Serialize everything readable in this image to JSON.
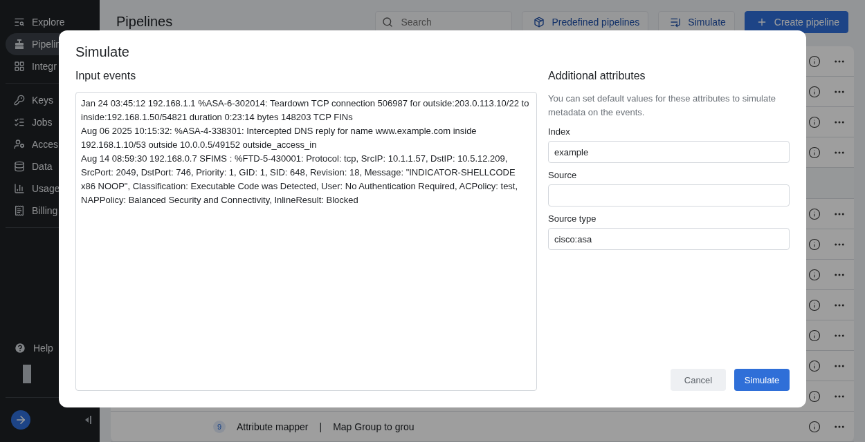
{
  "sidebar": {
    "groups": [
      [
        {
          "label": "Explore",
          "selected": false
        },
        {
          "label": "Pipelin",
          "selected": true
        },
        {
          "label": "Integr",
          "selected": false
        }
      ],
      [
        {
          "label": "Keys",
          "selected": false
        },
        {
          "label": "Jobs",
          "selected": false
        },
        {
          "label": "Acces",
          "selected": false
        },
        {
          "label": "Data",
          "selected": false
        },
        {
          "label": "Usage",
          "selected": false
        },
        {
          "label": "Billing",
          "selected": false
        }
      ]
    ],
    "help": "Help"
  },
  "header": {
    "title": "Pipelines",
    "search": {
      "placeholder": "Search"
    },
    "buttons": [
      {
        "label": "Predefined pipelines",
        "kind": "secondary"
      },
      {
        "label": "Simulate",
        "kind": "secondary"
      },
      {
        "label": "Create pipeline",
        "kind": "primary"
      }
    ]
  },
  "table": {
    "rows": [
      {
        "kind": "pipeline"
      },
      {
        "kind": "pipeline"
      },
      {
        "kind": "pipeline"
      },
      {
        "kind": "pipeline"
      },
      {
        "kind": "group"
      },
      {
        "kind": "pipeline"
      },
      {
        "kind": "pipeline"
      },
      {
        "kind": "pipeline"
      },
      {
        "kind": "pipeline"
      },
      {
        "kind": "pipeline"
      },
      {
        "kind": "pipeline"
      },
      {
        "kind": "pipeline"
      },
      {
        "kind": "pipeline",
        "number": "9",
        "name": "Attribute mapper",
        "separator": "|",
        "description": "Map Group to grou"
      }
    ]
  },
  "dialog": {
    "title": "Simulate",
    "input_label": "Input events",
    "events": [
      "Jan 24 03:45:12 192.168.1.1 %ASA-6-302014: Teardown TCP connection 506987 for outside:203.0.113.10/22 to inside:192.168.1.50/54821 duration 0:23:14 bytes 148203 TCP FINs",
      "Aug 06 2025 10:15:32: %ASA-4-338301: Intercepted DNS reply for name www.example.com inside 192.168.1.10/53 outside 10.0.0.5/49152 outside_access_in",
      "Aug 14 08:59:30 192.168.0.7 SFIMS : %FTD-5-430001: Protocol: tcp, SrcIP: 10.1.1.57, DstIP: 10.5.12.209, SrcPort: 2049, DstPort: 746, Priority: 1, GID: 1, SID: 648, Revision: 18, Message: \"INDICATOR-SHELLCODE x86 NOOP\", Classification: Executable Code was Detected, User: No Authentication Required, ACPolicy: test, NAPPolicy: Balanced Security and Connectivity, InlineResult: Blocked"
    ],
    "attributes_title": "Additional attributes",
    "attributes_help": "You can set default values for these attributes to simulate metadata on the events.",
    "fields": [
      {
        "label": "Index",
        "value": "example"
      },
      {
        "label": "Source"
      },
      {
        "label": "Source type",
        "value": "cisco:asa"
      }
    ],
    "buttons": [
      {
        "label": "Cancel",
        "kind": "secondary"
      },
      {
        "label": "Simulate",
        "kind": "primary"
      }
    ]
  }
}
